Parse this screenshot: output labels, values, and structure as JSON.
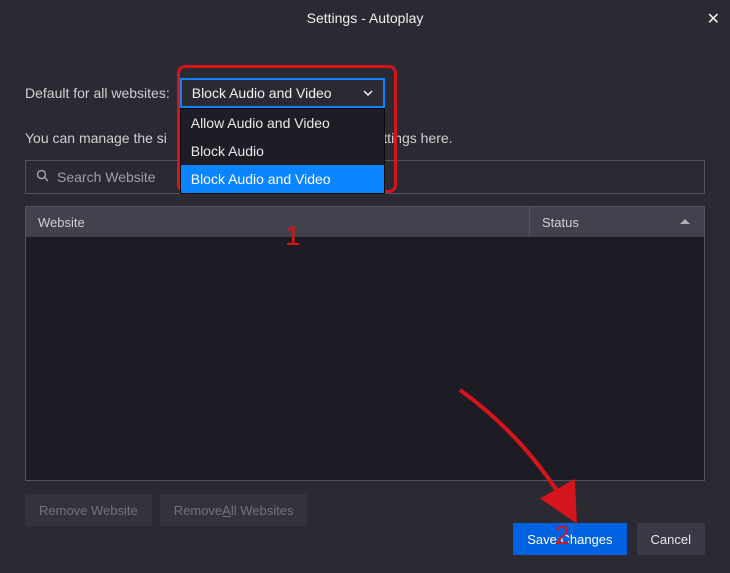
{
  "title": "Settings - Autoplay",
  "default_label": "Default for all websites:",
  "info_text_before": "You can manage the si",
  "info_text_after": "toplay settings here.",
  "search": {
    "placeholder": "Search Website"
  },
  "dropdown": {
    "selected": "Block Audio and Video",
    "options": [
      "Allow Audio and Video",
      "Block Audio",
      "Block Audio and Video"
    ]
  },
  "table": {
    "col_website": "Website",
    "col_status": "Status"
  },
  "buttons": {
    "remove": "Remove Website",
    "remove_all": "Remove All Websites",
    "save": "Save Changes",
    "cancel": "Cancel"
  },
  "annotations": {
    "one": "1",
    "two": "2"
  },
  "colors": {
    "accent": "#0a84ff",
    "danger": "#d4151b"
  }
}
